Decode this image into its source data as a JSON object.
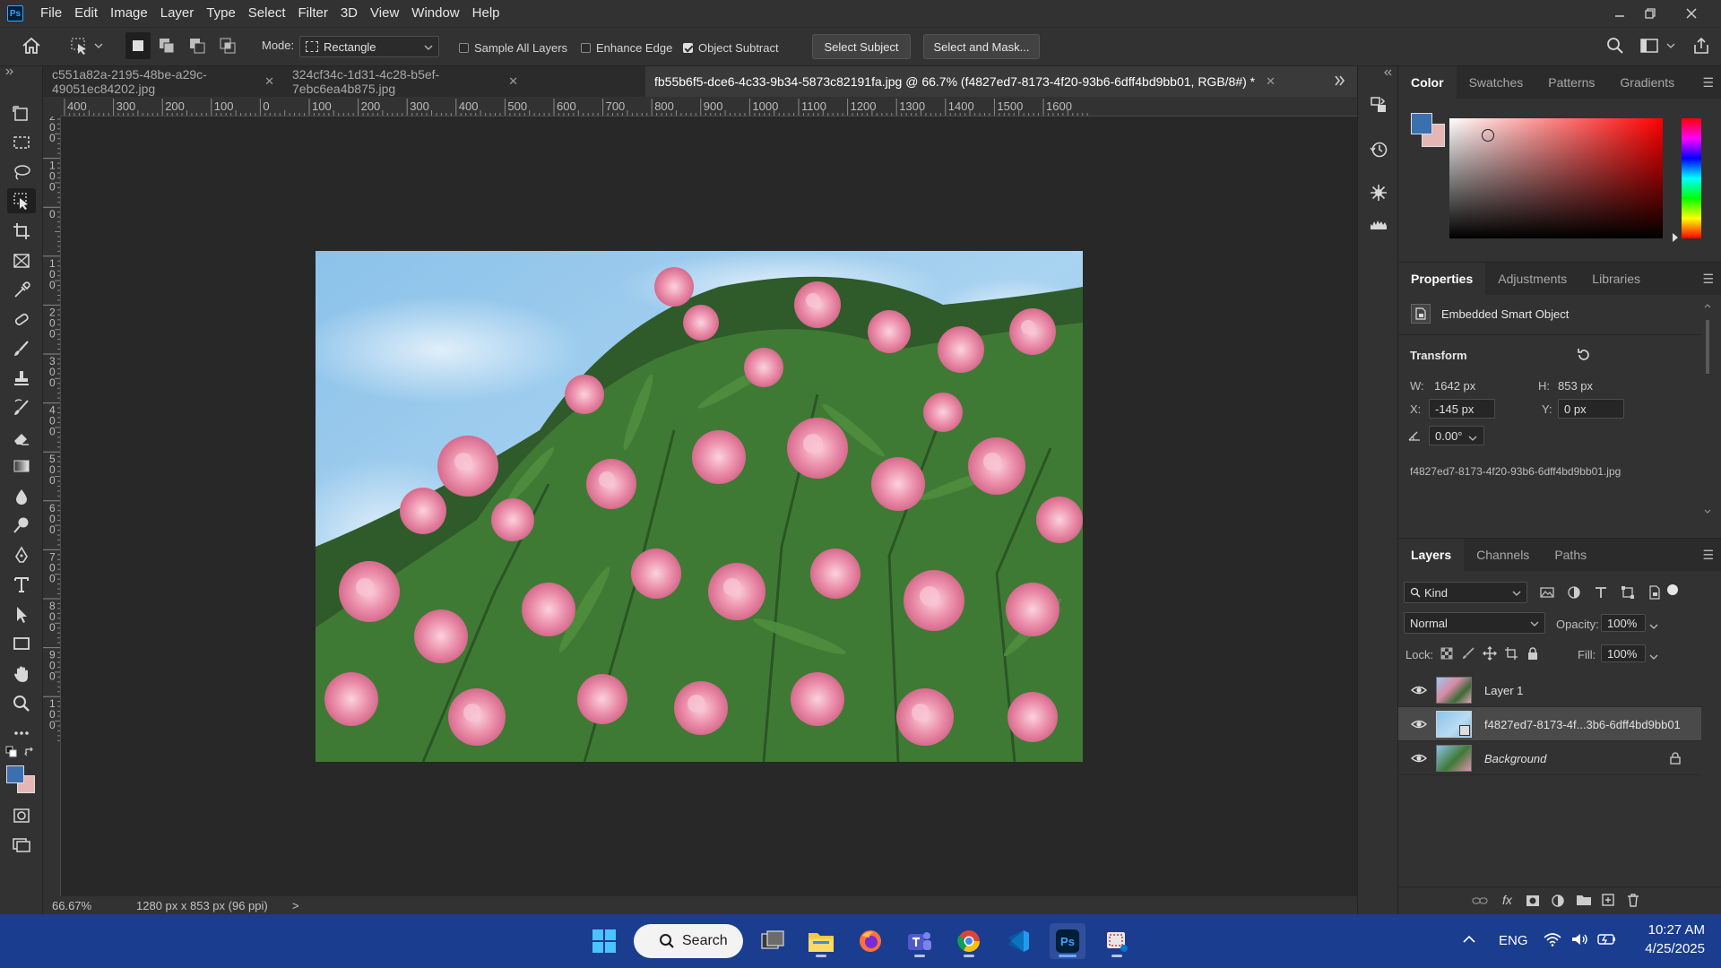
{
  "app": {
    "logo": "Ps",
    "menu": [
      "File",
      "Edit",
      "Image",
      "Layer",
      "Type",
      "Select",
      "Filter",
      "3D",
      "View",
      "Window",
      "Help"
    ]
  },
  "options": {
    "mode_label": "Mode:",
    "mode_value": "Rectangle",
    "sample_all_layers": "Sample All Layers",
    "enhance_edge": "Enhance Edge",
    "object_subtract": "Object Subtract",
    "object_subtract_checked": true,
    "select_subject": "Select Subject",
    "select_and_mask": "Select and Mask..."
  },
  "tabs": [
    {
      "title": "c551a82a-2195-48be-a29c-49051ec84202.jpg",
      "active": false
    },
    {
      "title": "324cf34c-1d31-4c28-b5ef-7ebc6ea4b875.jpg",
      "active": false
    },
    {
      "title": "fb55b6f5-dce6-4c33-9b34-5873c82191fa.jpg @ 66.7% (f4827ed7-8173-4f20-93b6-6dff4bd9bb01, RGB/8#) *",
      "active": true
    }
  ],
  "ruler_h": [
    "400",
    "300",
    "200",
    "100",
    "0",
    "100",
    "200",
    "300",
    "400",
    "500",
    "600",
    "700",
    "800",
    "900",
    "1000",
    "1100",
    "1200",
    "1300",
    "1400",
    "1500",
    "1600"
  ],
  "ruler_v": [
    "2\n0\n0",
    "1\n0\n0",
    "0",
    "1\n0\n0",
    "2\n0\n0",
    "3\n0\n0",
    "4\n0\n0",
    "5\n0\n0",
    "6\n0\n0",
    "7\n0\n0",
    "8\n0\n0",
    "9\n0\n0",
    "1\n0\n0"
  ],
  "status": {
    "zoom": "66.67%",
    "doc_info": "1280 px x 853 px (96 ppi)",
    "arrow": ">"
  },
  "color_panel": {
    "tabs": [
      "Color",
      "Swatches",
      "Patterns",
      "Gradients"
    ],
    "fg_color": "#3a6fb0",
    "bg_color": "#e6b6b6"
  },
  "properties": {
    "tabs": [
      "Properties",
      "Adjustments",
      "Libraries"
    ],
    "object_type": "Embedded Smart Object",
    "transform_title": "Transform",
    "w_label": "W:",
    "w_value": "1642 px",
    "h_label": "H:",
    "h_value": "853 px",
    "x_label": "X:",
    "x_value": "-145 px",
    "y_label": "Y:",
    "y_value": "0 px",
    "angle_value": "0.00°",
    "linked_file": "f4827ed7-8173-4f20-93b6-6dff4bd9bb01.jpg"
  },
  "layers": {
    "tabs": [
      "Layers",
      "Channels",
      "Paths"
    ],
    "filter_kind": "Kind",
    "blend_mode": "Normal",
    "opacity_label": "Opacity:",
    "opacity_value": "100%",
    "lock_label": "Lock:",
    "fill_label": "Fill:",
    "fill_value": "100%",
    "items": [
      {
        "name": "Layer 1",
        "selected": false,
        "italic": false
      },
      {
        "name": "f4827ed7-8173-4f...3b6-6dff4bd9bb01",
        "selected": true,
        "italic": false
      },
      {
        "name": "Background",
        "selected": false,
        "italic": true
      }
    ]
  },
  "taskbar": {
    "search_label": "Search",
    "lang": "ENG",
    "time": "10:27 AM",
    "date": "4/25/2025"
  }
}
